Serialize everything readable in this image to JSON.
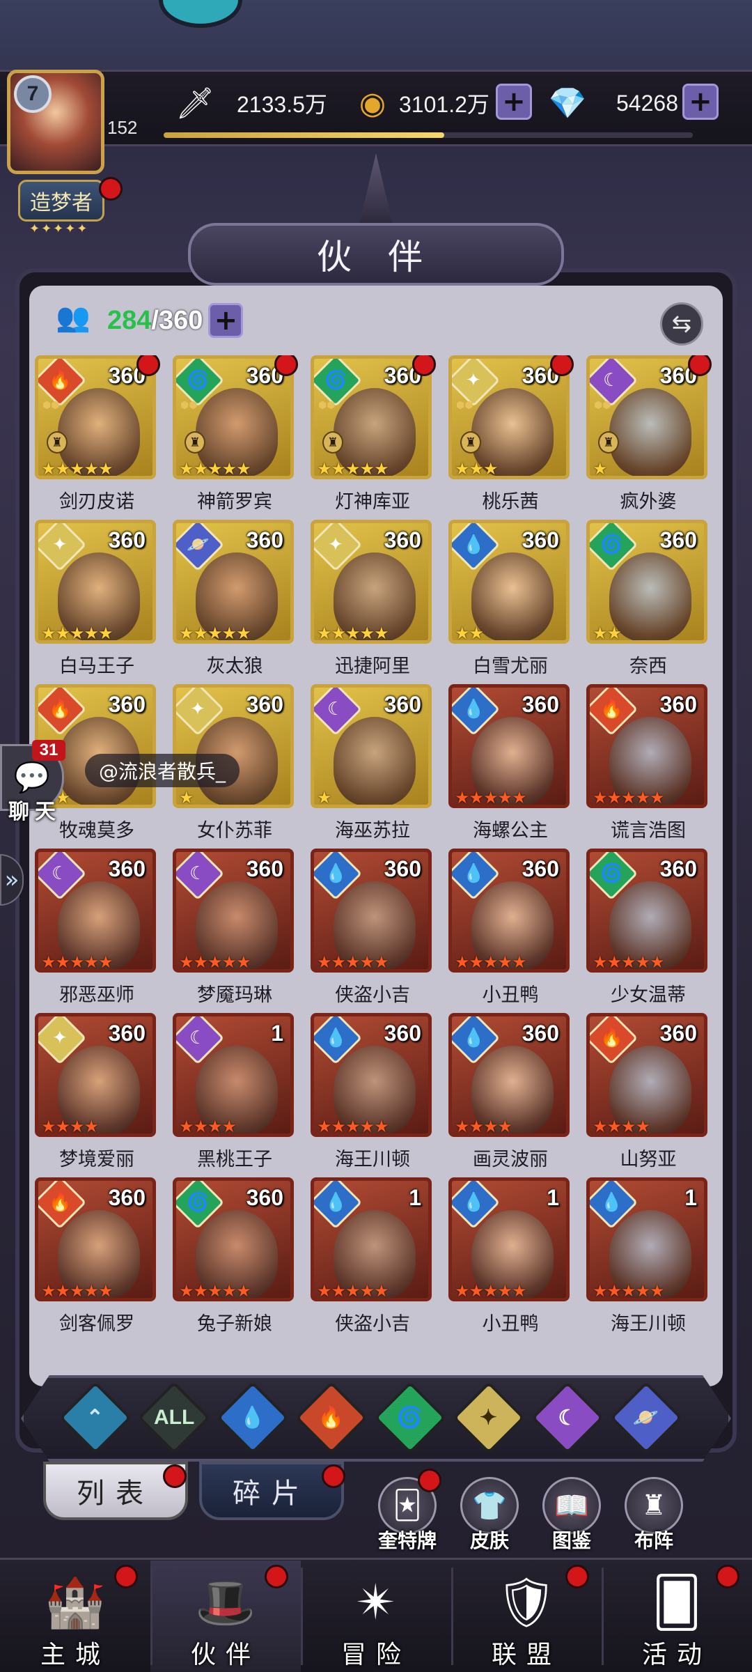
{
  "player": {
    "level": "7",
    "count": "152",
    "title": "造梦者",
    "title_stars": "✦✦✦✦✦",
    "exp_fraction": 0.53
  },
  "resources": {
    "power": "2133.5万",
    "gold": "3101.2万",
    "diamond": "54268"
  },
  "header": {
    "title": "伙 伴"
  },
  "roster": {
    "current": "284",
    "max": "/360"
  },
  "colors": {
    "fire": "#d94a2a",
    "water": "#2d6fc8",
    "wind": "#24a35a",
    "light": "#d9c15a",
    "dark": "#8a4cc2",
    "cosmic": "#4f5fc8"
  },
  "partners": [
    {
      "name": "剑刃皮诺",
      "level": "360",
      "element": "fire",
      "stars": 5,
      "star_color": "gold",
      "dot": true,
      "lock": true
    },
    {
      "name": "神箭罗宾",
      "level": "360",
      "element": "wind",
      "stars": 5,
      "star_color": "gold",
      "dot": true,
      "lock": true
    },
    {
      "name": "灯神库亚",
      "level": "360",
      "element": "wind",
      "stars": 5,
      "star_color": "gold",
      "dot": true,
      "lock": true
    },
    {
      "name": "桃乐茜",
      "level": "360",
      "element": "light",
      "stars": 3,
      "star_color": "gold",
      "dot": true,
      "lock": true
    },
    {
      "name": "疯外婆",
      "level": "360",
      "element": "dark",
      "stars": 1,
      "star_color": "gold",
      "dot": true,
      "lock": true
    },
    {
      "name": "白马王子",
      "level": "360",
      "element": "light",
      "stars": 5,
      "star_color": "gold",
      "dot": false,
      "lock": false
    },
    {
      "name": "灰太狼",
      "level": "360",
      "element": "cosmic",
      "stars": 5,
      "star_color": "gold",
      "dot": false,
      "lock": false
    },
    {
      "name": "迅捷阿里",
      "level": "360",
      "element": "light",
      "stars": 5,
      "star_color": "gold",
      "dot": false,
      "lock": false
    },
    {
      "name": "白雪尤丽",
      "level": "360",
      "element": "water",
      "stars": 2,
      "star_color": "gold",
      "dot": false,
      "lock": false
    },
    {
      "name": "奈西",
      "level": "360",
      "element": "wind",
      "stars": 2,
      "star_color": "gold",
      "dot": false,
      "lock": false
    },
    {
      "name": "牧魂莫多",
      "level": "360",
      "element": "fire",
      "stars": 2,
      "star_color": "gold",
      "dot": false,
      "lock": false
    },
    {
      "name": "女仆苏菲",
      "level": "360",
      "element": "light",
      "stars": 1,
      "star_color": "gold",
      "dot": false,
      "lock": false
    },
    {
      "name": "海巫苏拉",
      "level": "360",
      "element": "dark",
      "stars": 1,
      "star_color": "gold",
      "dot": false,
      "lock": false
    },
    {
      "name": "海螺公主",
      "level": "360",
      "element": "water",
      "stars": 5,
      "star_color": "red",
      "dot": false,
      "lock": false
    },
    {
      "name": "谎言浩图",
      "level": "360",
      "element": "fire",
      "stars": 5,
      "star_color": "red",
      "dot": false,
      "lock": false
    },
    {
      "name": "邪恶巫师",
      "level": "360",
      "element": "dark",
      "stars": 5,
      "star_color": "red",
      "dot": false,
      "lock": false
    },
    {
      "name": "梦魇玛琳",
      "level": "360",
      "element": "dark",
      "stars": 5,
      "star_color": "red",
      "dot": false,
      "lock": false
    },
    {
      "name": "侠盗小吉",
      "level": "360",
      "element": "water",
      "stars": 5,
      "star_color": "red",
      "dot": false,
      "lock": false
    },
    {
      "name": "小丑鸭",
      "level": "360",
      "element": "water",
      "stars": 5,
      "star_color": "red",
      "dot": false,
      "lock": false
    },
    {
      "name": "少女温蒂",
      "level": "360",
      "element": "wind",
      "stars": 5,
      "star_color": "red",
      "dot": false,
      "lock": false
    },
    {
      "name": "梦境爱丽",
      "level": "360",
      "element": "light",
      "stars": 4,
      "star_color": "red",
      "dot": false,
      "lock": false
    },
    {
      "name": "黑桃王子",
      "level": "1",
      "element": "dark",
      "stars": 4,
      "star_color": "red",
      "dot": false,
      "lock": false
    },
    {
      "name": "海王川顿",
      "level": "360",
      "element": "water",
      "stars": 5,
      "star_color": "red",
      "dot": false,
      "lock": false
    },
    {
      "name": "画灵波丽",
      "level": "360",
      "element": "water",
      "stars": 4,
      "star_color": "red",
      "dot": false,
      "lock": false
    },
    {
      "name": "山努亚",
      "level": "360",
      "element": "fire",
      "stars": 4,
      "star_color": "red",
      "dot": false,
      "lock": false
    },
    {
      "name": "剑客佩罗",
      "level": "360",
      "element": "fire",
      "stars": 5,
      "star_color": "red",
      "dot": false,
      "lock": false
    },
    {
      "name": "兔子新娘",
      "level": "360",
      "element": "wind",
      "stars": 5,
      "star_color": "red",
      "dot": false,
      "lock": false
    },
    {
      "name": "侠盗小吉",
      "level": "1",
      "element": "water",
      "stars": 5,
      "star_color": "red",
      "dot": false,
      "lock": false
    },
    {
      "name": "小丑鸭",
      "level": "1",
      "element": "water",
      "stars": 5,
      "star_color": "red",
      "dot": false,
      "lock": false
    },
    {
      "name": "海王川顿",
      "level": "1",
      "element": "water",
      "stars": 5,
      "star_color": "red",
      "dot": false,
      "lock": false
    }
  ],
  "chat": {
    "badge": "31",
    "label": "聊天",
    "message": "@流浪者散兵_"
  },
  "filters": [
    {
      "name": "cosmic-up",
      "label": "⌃",
      "color": "#2a7fa8",
      "text_color": "#cfe8ff"
    },
    {
      "name": "all",
      "label": "ALL",
      "color": "#2f3a36",
      "text_color": "#c8f0d0"
    },
    {
      "name": "water",
      "label": "💧",
      "color": "#2d6fc8",
      "text_color": "#ffffff"
    },
    {
      "name": "fire",
      "label": "🔥",
      "color": "#c9482a",
      "text_color": "#ffffff"
    },
    {
      "name": "wind",
      "label": "🌀",
      "color": "#24a35a",
      "text_color": "#ffffff"
    },
    {
      "name": "light",
      "label": "✦",
      "color": "#cdb45a",
      "text_color": "#3a2a00"
    },
    {
      "name": "dark",
      "label": "☾",
      "color": "#8a4cc2",
      "text_color": "#ffffff"
    },
    {
      "name": "cosmic",
      "label": "🪐",
      "color": "#4f5fc8",
      "text_color": "#ffffff"
    }
  ],
  "tabs": {
    "list": "列表",
    "fragments": "碎片"
  },
  "tools": [
    {
      "name": "奎特牌",
      "icon": "🃏"
    },
    {
      "name": "皮肤",
      "icon": "👕"
    },
    {
      "name": "图鉴",
      "icon": "📖"
    },
    {
      "name": "布阵",
      "icon": "♜"
    }
  ],
  "nav": [
    {
      "name": "主城",
      "icon": "🏰",
      "dot": true
    },
    {
      "name": "伙伴",
      "icon": "🎩",
      "dot": true
    },
    {
      "name": "冒险",
      "icon": "✴",
      "dot": false
    },
    {
      "name": "联盟",
      "icon": "🛡",
      "dot": true
    },
    {
      "name": "活动",
      "icon": "🂠",
      "dot": true
    }
  ]
}
